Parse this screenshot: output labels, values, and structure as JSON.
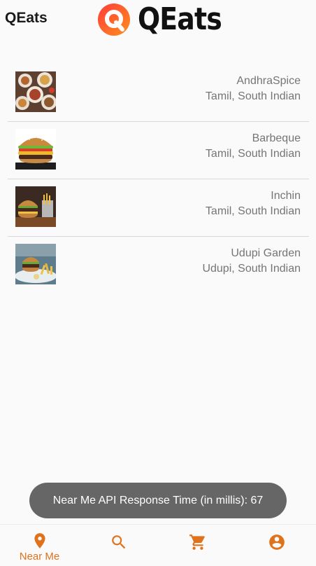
{
  "header": {
    "title": "QEats",
    "logo_text": "QEats"
  },
  "restaurants": [
    {
      "name": "AndhraSpice",
      "cuisine": "Tamil, South Indian"
    },
    {
      "name": "Barbeque",
      "cuisine": "Tamil, South Indian"
    },
    {
      "name": "Inchin",
      "cuisine": "Tamil, South Indian"
    },
    {
      "name": "Udupi Garden",
      "cuisine": "Udupi, South Indian"
    }
  ],
  "toast": {
    "message": "Near Me API Response Time (in millis): 67"
  },
  "bottom_nav": {
    "items": [
      {
        "label": "Near Me",
        "icon": "location-pin-icon",
        "active": true
      },
      {
        "label": "",
        "icon": "search-icon",
        "active": false
      },
      {
        "label": "",
        "icon": "cart-icon",
        "active": false
      },
      {
        "label": "",
        "icon": "account-icon",
        "active": false
      }
    ]
  },
  "colors": {
    "accent": "#e0721b",
    "logo_gradient_start": "#ff3d3d",
    "logo_gradient_end": "#ff8a1c",
    "toast_bg": "#666666"
  }
}
